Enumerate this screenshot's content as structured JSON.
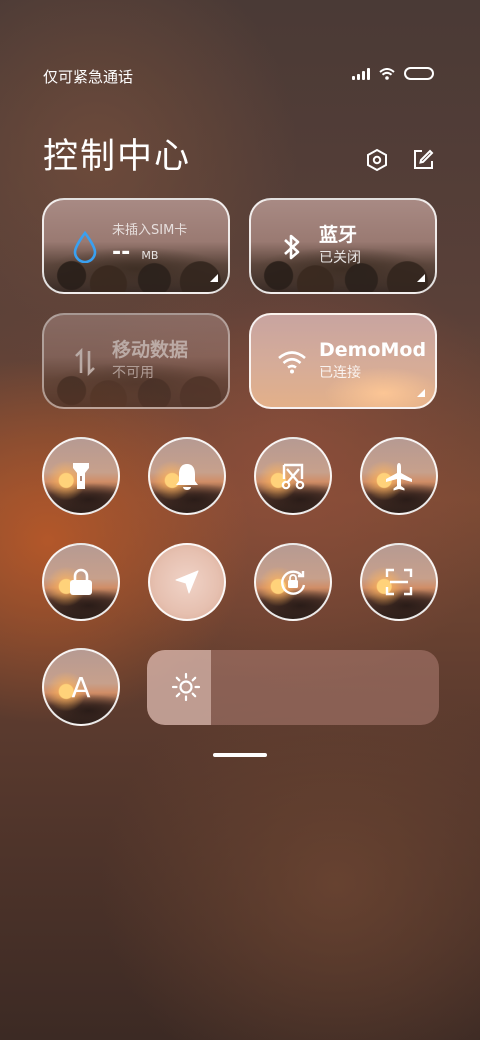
{
  "status_bar": {
    "carrier": "仅可紧急通话",
    "signal_icon": "signal-bars-icon",
    "wifi_icon": "wifi-icon",
    "battery_icon": "battery-icon"
  },
  "header": {
    "title": "控制中心",
    "settings_icon": "settings-hexagon-icon",
    "edit_icon": "edit-icon"
  },
  "large_tiles": [
    {
      "id": "data-usage",
      "title": "未插入SIM卡",
      "value": "--",
      "unit": "MB",
      "icon": "water-drop-icon",
      "accent": "#3aa0f0"
    },
    {
      "id": "bluetooth",
      "title": "蓝牙",
      "subtitle": "已关闭",
      "icon": "bluetooth-icon"
    },
    {
      "id": "mobile-data",
      "title": "移动数据",
      "subtitle": "不可用",
      "icon": "mobile-data-arrows-icon",
      "state": "disabled"
    },
    {
      "id": "wifi",
      "title": "DemoMod",
      "subtitle": "已连接",
      "icon": "wifi-icon",
      "state": "active"
    }
  ],
  "toggles": [
    {
      "id": "flashlight",
      "icon": "flashlight-icon"
    },
    {
      "id": "silent",
      "icon": "bell-icon"
    },
    {
      "id": "screenshot",
      "icon": "scissors-screenshot-icon"
    },
    {
      "id": "airplane",
      "icon": "airplane-icon"
    },
    {
      "id": "lock-screen",
      "icon": "lock-icon"
    },
    {
      "id": "location",
      "icon": "location-arrow-icon",
      "state": "on"
    },
    {
      "id": "rotation-lock",
      "icon": "rotation-lock-icon"
    },
    {
      "id": "scanner",
      "icon": "scan-frame-icon"
    },
    {
      "id": "auto-brightness",
      "icon": "letter-a-icon",
      "label": "A"
    }
  ],
  "brightness": {
    "level": 0.22,
    "icon": "sun-icon"
  }
}
